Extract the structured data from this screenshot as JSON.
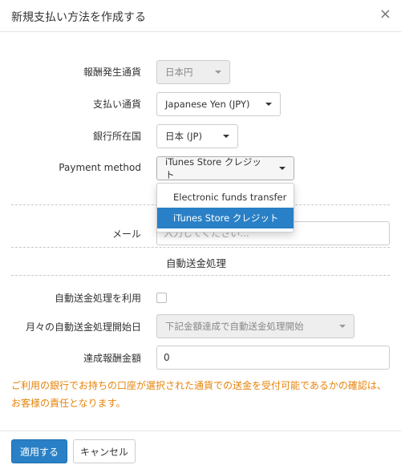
{
  "dialog": {
    "title": "新規支払い方法を作成する",
    "close_glyph": "×"
  },
  "form": {
    "earning_currency": {
      "label": "報酬発生通貨",
      "value": "日本円"
    },
    "payment_currency": {
      "label": "支払い通貨",
      "value": "Japanese Yen (JPY)"
    },
    "bank_country": {
      "label": "銀行所在国",
      "value": "日本 (JP)"
    },
    "payment_method": {
      "label": "Payment method",
      "value": "iTunes Store クレジット",
      "options": [
        "Electronic funds transfer",
        "iTunes Store クレジット"
      ],
      "selected_index": 1
    },
    "email": {
      "label": "メール",
      "placeholder": "入力してください..."
    },
    "auto_section_title": "自動送金処理",
    "auto_enable": {
      "label": "自動送金処理を利用",
      "checked": false
    },
    "auto_start": {
      "label": "月々の自動送金処理開始日",
      "value": "下記金額達成で自動送金処理開始"
    },
    "threshold": {
      "label": "達成報酬金額",
      "value": "0"
    }
  },
  "warning_text": "ご利用の銀行でお持ちの口座が選択された通貨での送金を受付可能であるかの確認は、お客様の責任となります。",
  "buttons": {
    "apply": "適用する",
    "cancel": "キャンセル"
  },
  "colors": {
    "primary": "#2a80c6",
    "warning": "#e5840b"
  }
}
